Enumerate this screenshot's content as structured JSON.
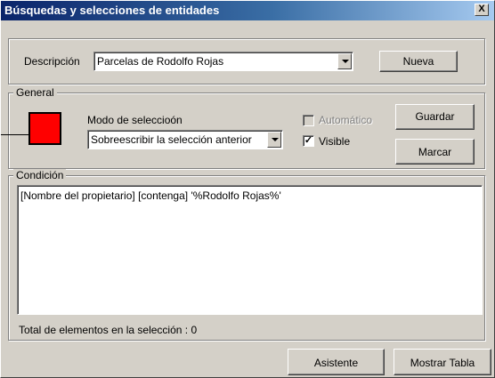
{
  "window": {
    "title": "Búsquedas y selecciones de entidades",
    "close_label": "X"
  },
  "description": {
    "label": "Descripción",
    "value": "Parcelas de Rodolfo Rojas",
    "new_button": "Nueva"
  },
  "general": {
    "group_label": "General",
    "color": "#ff0000",
    "mode_label": "Modo de seleccioón",
    "mode_value": "Sobreescribir la selección anterior",
    "automatic_label": "Automático",
    "automatic_checked": false,
    "visible_label": "Visible",
    "visible_checked": true,
    "save_button": "Guardar",
    "mark_button": "Marcar"
  },
  "condition": {
    "group_label": "Condición",
    "text": "[Nombre del propietario] [contenga] '%Rodolfo Rojas%'",
    "total_text": "Total de elementos en la  selección : 0"
  },
  "footer": {
    "wizard_button": "Asistente",
    "show_table_button": "Mostrar Tabla"
  }
}
